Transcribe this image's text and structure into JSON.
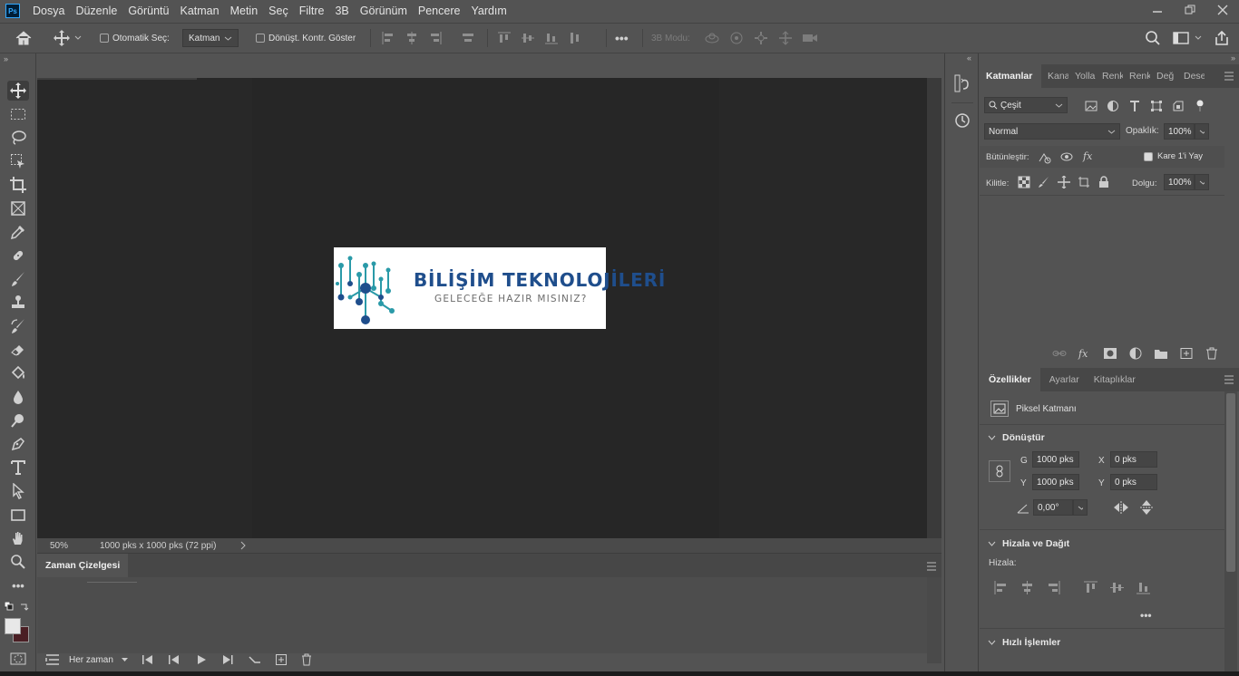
{
  "menubar": {
    "app_badge": "Ps",
    "items": [
      "Dosya",
      "Düzenle",
      "Görüntü",
      "Katman",
      "Metin",
      "Seç",
      "Filtre",
      "3B",
      "Görünüm",
      "Pencere",
      "Yardım"
    ]
  },
  "options": {
    "auto_select_label": "Otomatik Seç:",
    "auto_select_target": "Katman",
    "show_transform_label": "Dönüşt. Kontr. Göster",
    "more": "•••",
    "mode_3d": "3B Modu:"
  },
  "canvas": {
    "logo_title": "BİLİŞİM TEKNOLOJİLERİ",
    "logo_subtitle": "GELECEĞE HAZIR MISINIZ?",
    "zoom": "50%",
    "doc_info": "1000 pks x 1000 pks (72 ppi)"
  },
  "timeline": {
    "title": "Zaman Çizelgesi",
    "loop": "Her zaman"
  },
  "layers_panel": {
    "tabs": [
      "Katmanlar",
      "Kana",
      "Yolla",
      "Renk",
      "Renk",
      "Değ",
      "Dese"
    ],
    "filter_kind": "Çeşit",
    "blend_mode": "Normal",
    "opacity_label": "Opaklık:",
    "opacity": "100%",
    "unify_label": "Bütünleştir:",
    "propagate_label": "Kare 1'i Yay",
    "lock_label": "Kilitle:",
    "fill_label": "Dolgu:",
    "fill": "100%"
  },
  "properties_panel": {
    "tabs": [
      "Özellikler",
      "Ayarlar",
      "Kitaplıklar"
    ],
    "layer_type": "Piksel Katmanı",
    "transform_title": "Dönüştür",
    "w_label": "G",
    "w_value": "1000 pks",
    "h_label": "Y",
    "h_value": "1000 pks",
    "x_label": "X",
    "x_value": "0 pks",
    "y_label": "Y",
    "y_value": "0 pks",
    "angle": "0,00°",
    "align_title": "Hizala ve Dağıt",
    "align_label": "Hizala:",
    "quick_actions_title": "Hızlı İşlemler",
    "more": "•••"
  },
  "colors": {
    "foreground": "#e8e8e8",
    "background": "#4a1f24",
    "logo_blue": "#1f4e8c",
    "logo_teal": "#2a9aa8"
  }
}
